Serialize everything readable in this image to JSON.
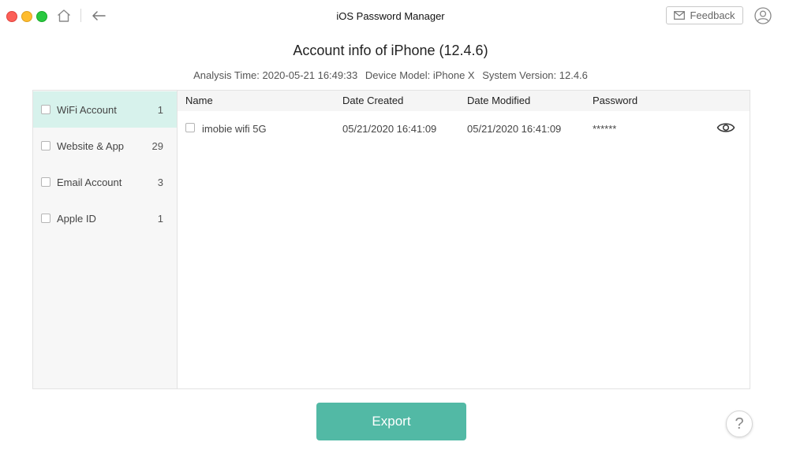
{
  "window": {
    "title": "iOS Password Manager"
  },
  "toolbar": {
    "feedback_label": "Feedback"
  },
  "header": {
    "title": "Account info of iPhone (12.4.6)",
    "analysis_time": "Analysis Time: 2020-05-21 16:49:33",
    "device_model": "Device Model: iPhone X",
    "system_version": "System Version: 12.4.6"
  },
  "sidebar": {
    "items": [
      {
        "label": "WiFi Account",
        "count": "1",
        "active": true
      },
      {
        "label": "Website & App",
        "count": "29",
        "active": false
      },
      {
        "label": "Email Account",
        "count": "3",
        "active": false
      },
      {
        "label": "Apple ID",
        "count": "1",
        "active": false
      }
    ]
  },
  "table": {
    "columns": [
      "Name",
      "Date Created",
      "Date Modified",
      "Password"
    ],
    "rows": [
      {
        "name": "imobie wifi 5G",
        "date_created": "05/21/2020 16:41:09",
        "date_modified": "05/21/2020 16:41:09",
        "password": "******"
      }
    ]
  },
  "footer": {
    "export_label": "Export",
    "help_label": "?"
  },
  "colors": {
    "accent": "#52b9a5",
    "active_bg": "#d7f2ec"
  },
  "icons": [
    "home-icon",
    "back-arrow-icon",
    "mail-icon",
    "user-icon",
    "eye-icon",
    "help-icon"
  ]
}
